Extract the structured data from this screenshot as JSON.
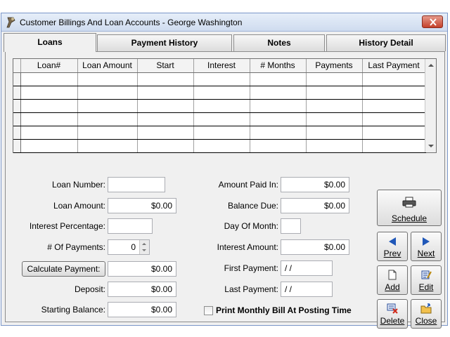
{
  "window": {
    "title": "Customer Billings And Loan Accounts - George Washington"
  },
  "tabs": [
    {
      "label": "Loans",
      "active": true
    },
    {
      "label": "Payment History",
      "active": false
    },
    {
      "label": "Notes",
      "active": false
    },
    {
      "label": "History Detail",
      "active": false
    }
  ],
  "grid": {
    "columns": [
      "Loan#",
      "Loan Amount",
      "Start",
      "Interest",
      "# Months",
      "Payments",
      "Last Payment"
    ]
  },
  "form": {
    "loan_number": {
      "label": "Loan Number:",
      "value": ""
    },
    "loan_amount": {
      "label": "Loan Amount:",
      "value": "$0.00"
    },
    "interest_percentage": {
      "label": "Interest Percentage:",
      "value": ""
    },
    "num_payments": {
      "label": "# Of Payments:",
      "value": "0"
    },
    "calculate_payment": {
      "label": "Calculate Payment:",
      "value": "$0.00"
    },
    "deposit": {
      "label": "Deposit:",
      "value": "$0.00"
    },
    "starting_balance": {
      "label": "Starting Balance:",
      "value": "$0.00"
    },
    "amount_paid_in": {
      "label": "Amount Paid In:",
      "value": "$0.00"
    },
    "balance_due": {
      "label": "Balance Due:",
      "value": "$0.00"
    },
    "day_of_month": {
      "label": "Day Of Month:",
      "value": ""
    },
    "interest_amount": {
      "label": "Interest Amount:",
      "value": "$0.00"
    },
    "first_payment": {
      "label": "First Payment:",
      "value": " / /"
    },
    "last_payment": {
      "label": "Last Payment:",
      "value": " / /"
    },
    "print_monthly_bill": {
      "label": "Print Monthly Bill At Posting Time",
      "checked": false
    }
  },
  "actions": {
    "schedule": "Schedule",
    "prev": "Prev",
    "next": "Next",
    "add": "Add",
    "edit": "Edit",
    "delete": "Delete",
    "close": "Close"
  },
  "colors": {
    "accent": "#1f57b8",
    "close_button": "#c5412a"
  }
}
